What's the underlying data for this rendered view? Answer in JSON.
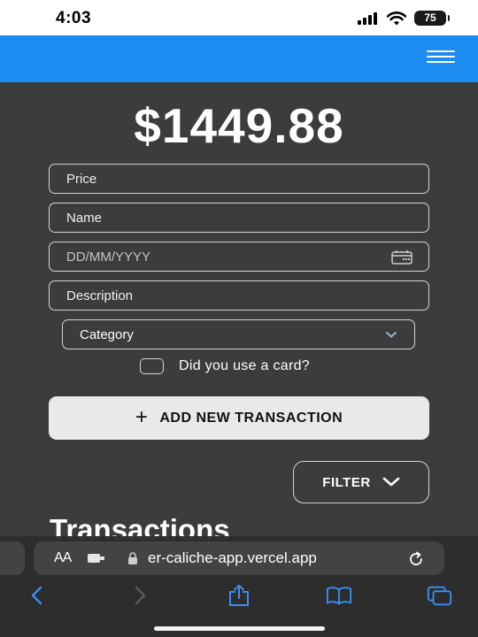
{
  "status_bar": {
    "time": "4:03",
    "battery": "75"
  },
  "header": {
    "menu_icon": "hamburger-menu-icon"
  },
  "balance": "$1449.88",
  "form": {
    "price_placeholder": "Price",
    "name_placeholder": "Name",
    "date_placeholder": "DD/MM/YYYY",
    "description_placeholder": "Description",
    "category_label": "Category",
    "card_label": "Did you use a card?",
    "add_button_icon": "+",
    "add_button_label": "ADD NEW TRANSACTION"
  },
  "filter_button_label": "FILTER",
  "transactions_title": "Transactions",
  "browser": {
    "text_size_label": "AA",
    "url": "er-caliche-app.vercel.app",
    "icons": [
      "extension-icon",
      "lock-icon",
      "reload-icon",
      "back-icon",
      "forward-icon",
      "share-icon",
      "bookmarks-icon",
      "tabs-icon"
    ]
  },
  "colors": {
    "header_blue": "#1d8cf0",
    "background": "#3c3c3c",
    "ios_blue": "#3a8ef5"
  }
}
